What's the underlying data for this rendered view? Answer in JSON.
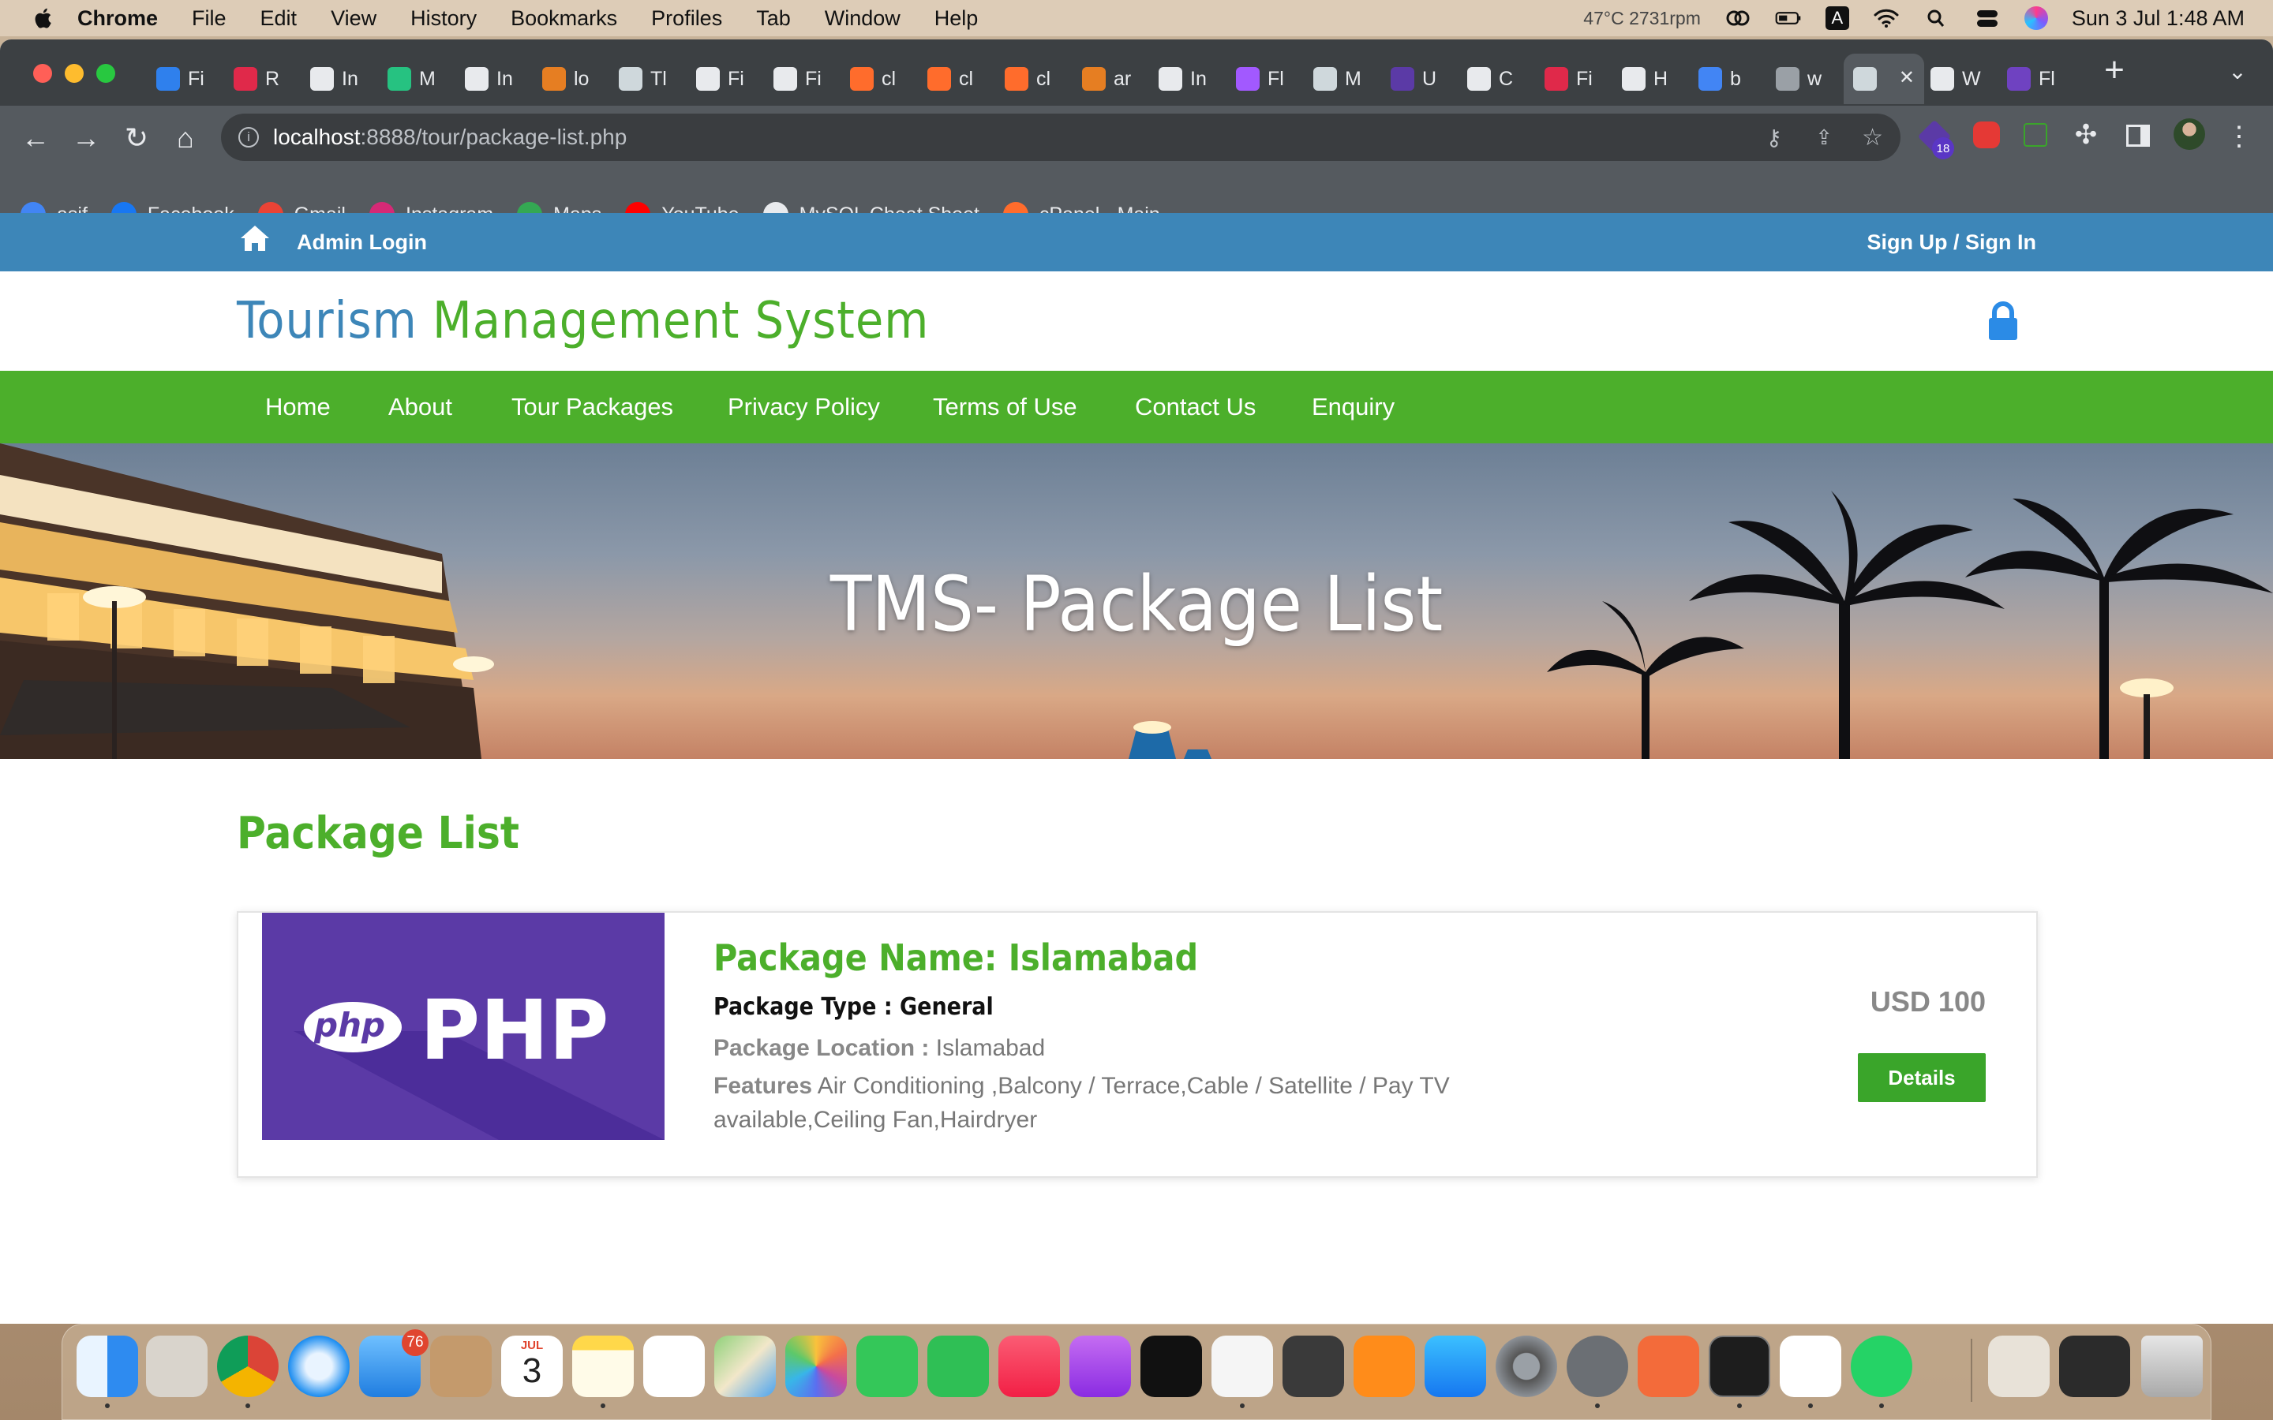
{
  "menubar": {
    "items": [
      "Chrome",
      "File",
      "Edit",
      "View",
      "History",
      "Bookmarks",
      "Profiles",
      "Tab",
      "Window",
      "Help"
    ],
    "status_temp": "47°C 2731rpm",
    "input_source": "A",
    "datetime": "Sun 3 Jul  1:48 AM"
  },
  "tabs": [
    {
      "label": "Fi",
      "color": "#2f80ed"
    },
    {
      "label": "R",
      "color": "#e0294a"
    },
    {
      "label": "In",
      "color": "#e8eaed"
    },
    {
      "label": "M",
      "color": "#26c281"
    },
    {
      "label": "In",
      "color": "#e8eaed"
    },
    {
      "label": "lo",
      "color": "#e67e22"
    },
    {
      "label": "Tl",
      "color": "#cfd8dc"
    },
    {
      "label": "Fi",
      "color": "#e8eaed"
    },
    {
      "label": "Fi",
      "color": "#e8eaed"
    },
    {
      "label": "cl",
      "color": "#ff6c2c"
    },
    {
      "label": "cl",
      "color": "#ff6c2c"
    },
    {
      "label": "cl",
      "color": "#ff6c2c"
    },
    {
      "label": "ar",
      "color": "#e67e22"
    },
    {
      "label": "In",
      "color": "#e8eaed"
    },
    {
      "label": "Fl",
      "color": "#a259ff"
    },
    {
      "label": "M",
      "color": "#cfd8dc"
    },
    {
      "label": "U",
      "color": "#5b3aa6"
    },
    {
      "label": "C",
      "color": "#e8eaed"
    },
    {
      "label": "Fi",
      "color": "#e0294a"
    },
    {
      "label": "H",
      "color": "#e8eaed"
    },
    {
      "label": "b",
      "color": "#4285f4"
    },
    {
      "label": "w",
      "color": "#9aa0a6"
    },
    {
      "label": "",
      "color": "#cfd8dc"
    },
    {
      "label": "W",
      "color": "#e8eaed"
    },
    {
      "label": "Fl",
      "color": "#6f42c1"
    }
  ],
  "address": {
    "host": "localhost",
    "path": ":8888/tour/package-list.php"
  },
  "extensions": {
    "badge_count": "18"
  },
  "bookmarks": [
    {
      "label": "asif",
      "icon": "google-icon",
      "color": "#4285f4"
    },
    {
      "label": "Facebook",
      "icon": "facebook-icon",
      "color": "#1877f2"
    },
    {
      "label": "Gmail",
      "icon": "gmail-icon",
      "color": "#ea4335"
    },
    {
      "label": "Instagram",
      "icon": "instagram-icon",
      "color": "#d62976"
    },
    {
      "label": "Maps",
      "icon": "maps-icon",
      "color": "#34a853"
    },
    {
      "label": "YouTube",
      "icon": "youtube-icon",
      "color": "#ff0000"
    },
    {
      "label": "MySQL Cheat Sheet",
      "icon": "github-icon",
      "color": "#e8eaed"
    },
    {
      "label": "cPanel - Main",
      "icon": "cpanel-icon",
      "color": "#ff6c2c"
    }
  ],
  "site": {
    "admin_login": "Admin Login",
    "signin": "Sign Up / Sign In",
    "logo_part1": "Tourism",
    "logo_part2": "Management System",
    "nav": [
      "Home",
      "About",
      "Tour Packages",
      "Privacy Policy",
      "Terms of Use",
      "Contact Us",
      "Enquiry"
    ],
    "banner_title": "TMS- Package List",
    "section_title": "Package List",
    "colors": {
      "blue": "#3d86b8",
      "green": "#4caf2b"
    }
  },
  "package": {
    "thumb_logo_text": "php",
    "thumb_big_text": "PHP",
    "name": "Package Name: Islamabad",
    "type": "Package Type : General",
    "location_label": "Package Location :",
    "location_value": "Islamabad",
    "features_label": "Features",
    "features_value": "Air Conditioning ,Balcony / Terrace,Cable / Satellite / Pay TV available,Ceiling Fan,Hairdryer",
    "price": "USD 100",
    "details_button": "Details"
  },
  "dock": {
    "mail_badge": "76",
    "calendar_month": "JUL",
    "calendar_day": "3"
  }
}
